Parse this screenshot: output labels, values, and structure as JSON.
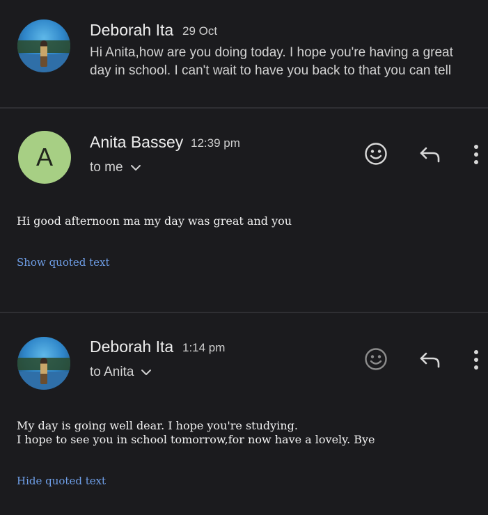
{
  "messages": [
    {
      "sender": "Deborah Ita",
      "date": "29 Oct",
      "snippet_line1": "Hi Anita,how are you doing today. I hope you're having a great",
      "snippet_line2": "day in school. I can't wait to have you back to that you can tell",
      "avatar": "profile-photo"
    },
    {
      "sender": "Anita Bassey",
      "time": "12:39 pm",
      "avatar_letter": "A",
      "avatar_color": "#a7cf84",
      "recipient": "to me",
      "body": [
        "Hi good afternoon ma my day was great and you"
      ],
      "quoted_toggle": "Show quoted text"
    },
    {
      "sender": "Deborah Ita",
      "time": "1:14 pm",
      "avatar": "profile-photo",
      "recipient": "to Anita",
      "body": [
        "My day is going well dear. I hope you're studying.",
        "I hope to see you in school tomorrow,for now have a lovely. Bye"
      ],
      "quoted_toggle": "Hide quoted text"
    }
  ],
  "icons": [
    "emoji-icon",
    "reply-icon",
    "more-vert-icon",
    "chevron-down-icon"
  ],
  "colors": {
    "background": "#1b1b1e",
    "link": "#6f9fe8",
    "divider": "#2f2f33"
  }
}
